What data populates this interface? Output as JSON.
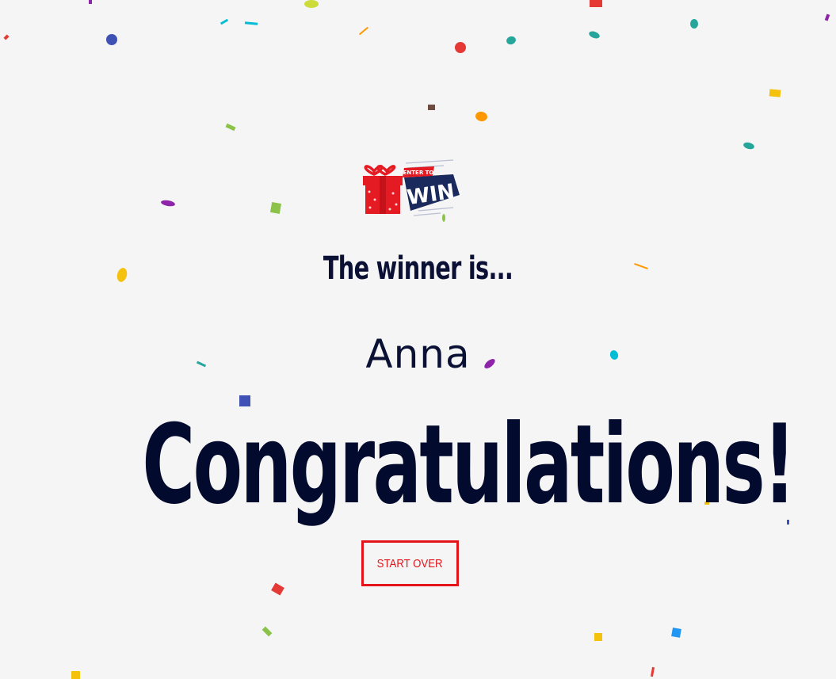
{
  "logo": {
    "tag_text": "ENTER TO",
    "main_text": "WIN",
    "icon": "gift-box-icon",
    "colors": {
      "gift": "#e51b23",
      "banner": "#1b2a5c",
      "text": "#ffffff"
    }
  },
  "result": {
    "heading": "The winner is...",
    "winner_name": "Anna",
    "congrats": "Congratulations!"
  },
  "actions": {
    "start_over_label": "START OVER"
  },
  "colors": {
    "background": "#f5f5f5",
    "text_dark": "#0b1035",
    "accent_red": "#e3141a"
  },
  "confetti_palette": [
    "#f4c20d",
    "#3f51b5",
    "#e53935",
    "#26a69a",
    "#8e24aa",
    "#00bcd4",
    "#ff9800",
    "#8bc34a",
    "#cddc39",
    "#6d4c41",
    "#2196f3"
  ]
}
